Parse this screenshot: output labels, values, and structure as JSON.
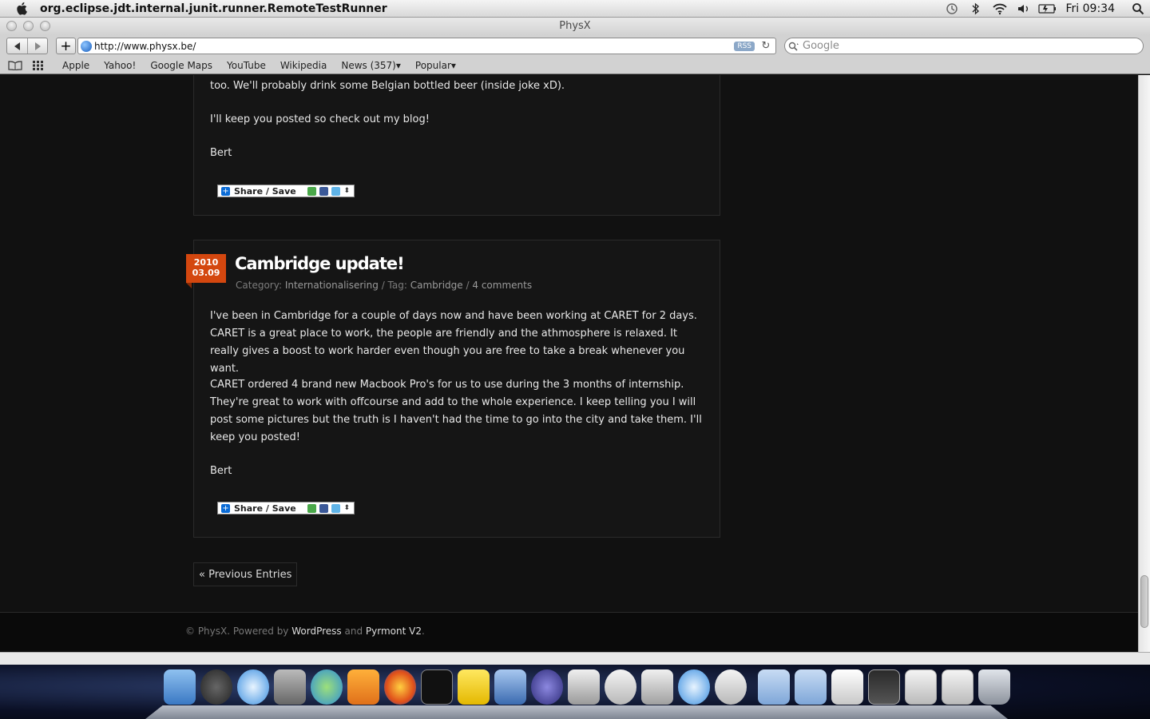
{
  "menubar": {
    "app_name": "org.eclipse.jdt.internal.junit.runner.RemoteTestRunner",
    "clock": "Fri 09:34"
  },
  "window": {
    "title": "PhysX"
  },
  "toolbar": {
    "url": "http://www.physx.be/",
    "rss_label": "RSS",
    "search_placeholder": "Google"
  },
  "bookmarks": [
    "Apple",
    "Yahoo!",
    "Google Maps",
    "YouTube",
    "Wikipedia",
    "News (357)▾",
    "Popular▾"
  ],
  "post1": {
    "lines": [
      "too. We'll probably drink some Belgian bottled beer (inside joke xD).",
      "I'll keep you posted so check out my blog!",
      "Bert"
    ],
    "share_label": "Share / Save"
  },
  "post2": {
    "date_year": "2010",
    "date_day": "03.09",
    "title": "Cambridge update!",
    "meta": {
      "category_label": "Category:",
      "category": "Internationalisering",
      "tag_label": "/ Tag:",
      "tag": "Cambridge",
      "sep": "/",
      "comments": "4 comments"
    },
    "paragraph1": "I've been in Cambridge for a couple of days now and have been working at CARET for 2 days. CARET is a great place to work, the people are friendly and the athmosphere is relaxed. It really gives a boost to work harder even though you are free to take a break whenever you want.",
    "paragraph2": "CARET ordered 4 brand new Macbook Pro's for us to use during the 3 months of internship. They're great to work with offcourse and add to the whole experience. I keep telling you I will post some pictures but the truth is I haven't had the time to go into the city and take them. I'll keep you posted!",
    "signature": "Bert",
    "share_label": "Share / Save"
  },
  "pagination": {
    "previous": "« Previous Entries"
  },
  "footer": {
    "prefix": "© PhysX. Powered by",
    "wordpress": "WordPress",
    "and": "and",
    "theme": "Pyrmont V2",
    "suffix": "."
  },
  "dock": {
    "icons": [
      "finder-icon",
      "dashboard-icon",
      "safari-icon",
      "system-preferences-icon",
      "ichat-icon",
      "settings-gear-icon",
      "firefox-icon",
      "terminal-icon",
      "adium-bird-icon",
      "mail-icon",
      "eclipse-icon",
      "iphoto-icon",
      "java-cup-icon",
      "network-utility-icon",
      "safari-icon",
      "java-cup-icon",
      "applications-folder-icon",
      "documents-folder-icon",
      "document-stack-icon",
      "window-thumbnail-icon",
      "window-thumbnail-icon",
      "window-thumbnail-icon",
      "trash-icon"
    ]
  }
}
